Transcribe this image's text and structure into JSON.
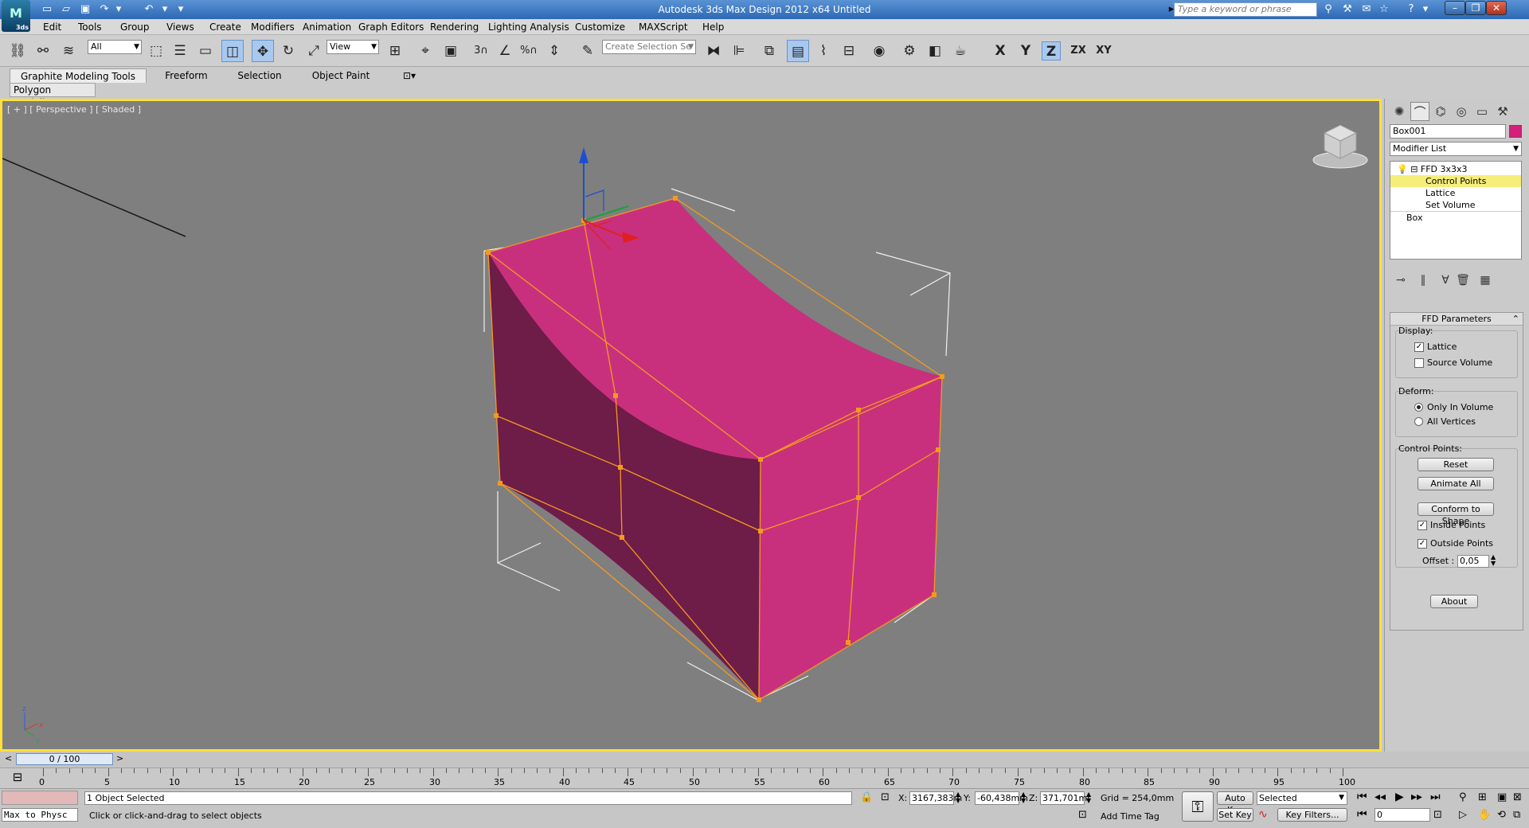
{
  "titlebar": {
    "logo": "3ds",
    "title": "Autodesk 3ds Max Design 2012 x64      Untitled",
    "search_placeholder": "Type a keyword or phrase"
  },
  "menu": [
    "Edit",
    "Tools",
    "Group",
    "Views",
    "Create",
    "Modifiers",
    "Animation",
    "Graph Editors",
    "Rendering",
    "Lighting Analysis",
    "Customize",
    "MAXScript",
    "Help"
  ],
  "toolbar": {
    "selection_filter": "All",
    "ref_coord": "View",
    "named_selection_placeholder": "Create Selection Se",
    "axis": [
      "X",
      "Y",
      "Z",
      "ZX",
      "XY"
    ],
    "active_axis": "Z"
  },
  "ribbon": {
    "tabs": [
      "Graphite Modeling Tools",
      "Freeform",
      "Selection",
      "Object Paint"
    ],
    "panel": "Polygon Modeling"
  },
  "viewport": {
    "label": "[ + ] [ Perspective ] [ Shaded ]",
    "object_color": "#c8307e",
    "object_dark": "#6e1c48",
    "lattice_color": "#f39a1e"
  },
  "command_panel": {
    "object_name": "Box001",
    "object_color": "#d4207a",
    "modifier_list": "Modifier List",
    "stack": [
      {
        "label": "FFD 3x3x3",
        "indent": 0
      },
      {
        "label": "Control Points",
        "indent": 1,
        "selected": true
      },
      {
        "label": "Lattice",
        "indent": 1
      },
      {
        "label": "Set Volume",
        "indent": 1
      },
      {
        "label": "Box",
        "indent": 0
      }
    ],
    "rollout_title": "FFD Parameters",
    "display_label": "Display:",
    "lattice": "Lattice",
    "lattice_checked": true,
    "source_volume": "Source Volume",
    "source_volume_checked": false,
    "deform_label": "Deform:",
    "only_in_volume": "Only In Volume",
    "all_vertices": "All Vertices",
    "deform_mode": "Only In Volume",
    "control_points_label": "Control Points:",
    "reset": "Reset",
    "animate_all": "Animate All",
    "conform_to_shape": "Conform to Shape",
    "inside_points": "Inside Points",
    "inside_checked": true,
    "outside_points": "Outside Points",
    "outside_checked": true,
    "offset_label": "Offset :",
    "offset_value": "0,05",
    "about": "About"
  },
  "timeline": {
    "frame": "0 / 100",
    "ticks": [
      0,
      5,
      10,
      15,
      20,
      25,
      30,
      35,
      40,
      45,
      50,
      55,
      60,
      65,
      70,
      75,
      80,
      85,
      90,
      95,
      100
    ]
  },
  "status": {
    "script_listener": "Max to Physc",
    "selected": "1 Object Selected",
    "prompt": "Click or click-and-drag to select objects",
    "x_label": "X:",
    "x": "3167,383m",
    "y_label": "Y:",
    "y": "-60,438mm",
    "z_label": "Z:",
    "z": "371,701mr",
    "grid": "Grid = 254,0mm",
    "add_time_tag": "Add Time Tag",
    "auto_key": "Auto Key",
    "set_key": "Set Key",
    "key_mode": "Selected",
    "key_filters": "Key Filters...",
    "current_frame": "0"
  }
}
